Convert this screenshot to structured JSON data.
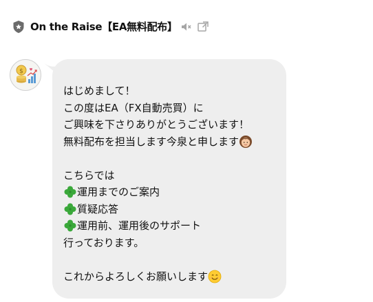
{
  "header": {
    "title": "On the Raise【EA無料配布】",
    "badge_icon": "shield-icon",
    "mute_icon": "speaker-muted-icon",
    "external_icon": "external-window-icon"
  },
  "sender": {
    "avatar_icon": "coins-chart-avatar"
  },
  "message": {
    "lines": [
      "はじめまして！",
      "この度はEA（FX自動売買）に",
      "ご興味を下さりありがとうございます！",
      "無料配布を担当します今泉と申します",
      "",
      "こちらでは",
      "運用までのご案内",
      "質疑応答",
      "運用前、運用後のサポート",
      "行っております。",
      "",
      "これからよろしくお願いします"
    ],
    "emojis": {
      "woman": "woman-emoji",
      "clover": "four-leaf-clover-emoji",
      "smile": "smiling-face-emoji"
    }
  },
  "colors": {
    "bubble": "#eeeeee",
    "text": "#111111",
    "icon_gray": "#9a9a9a"
  }
}
